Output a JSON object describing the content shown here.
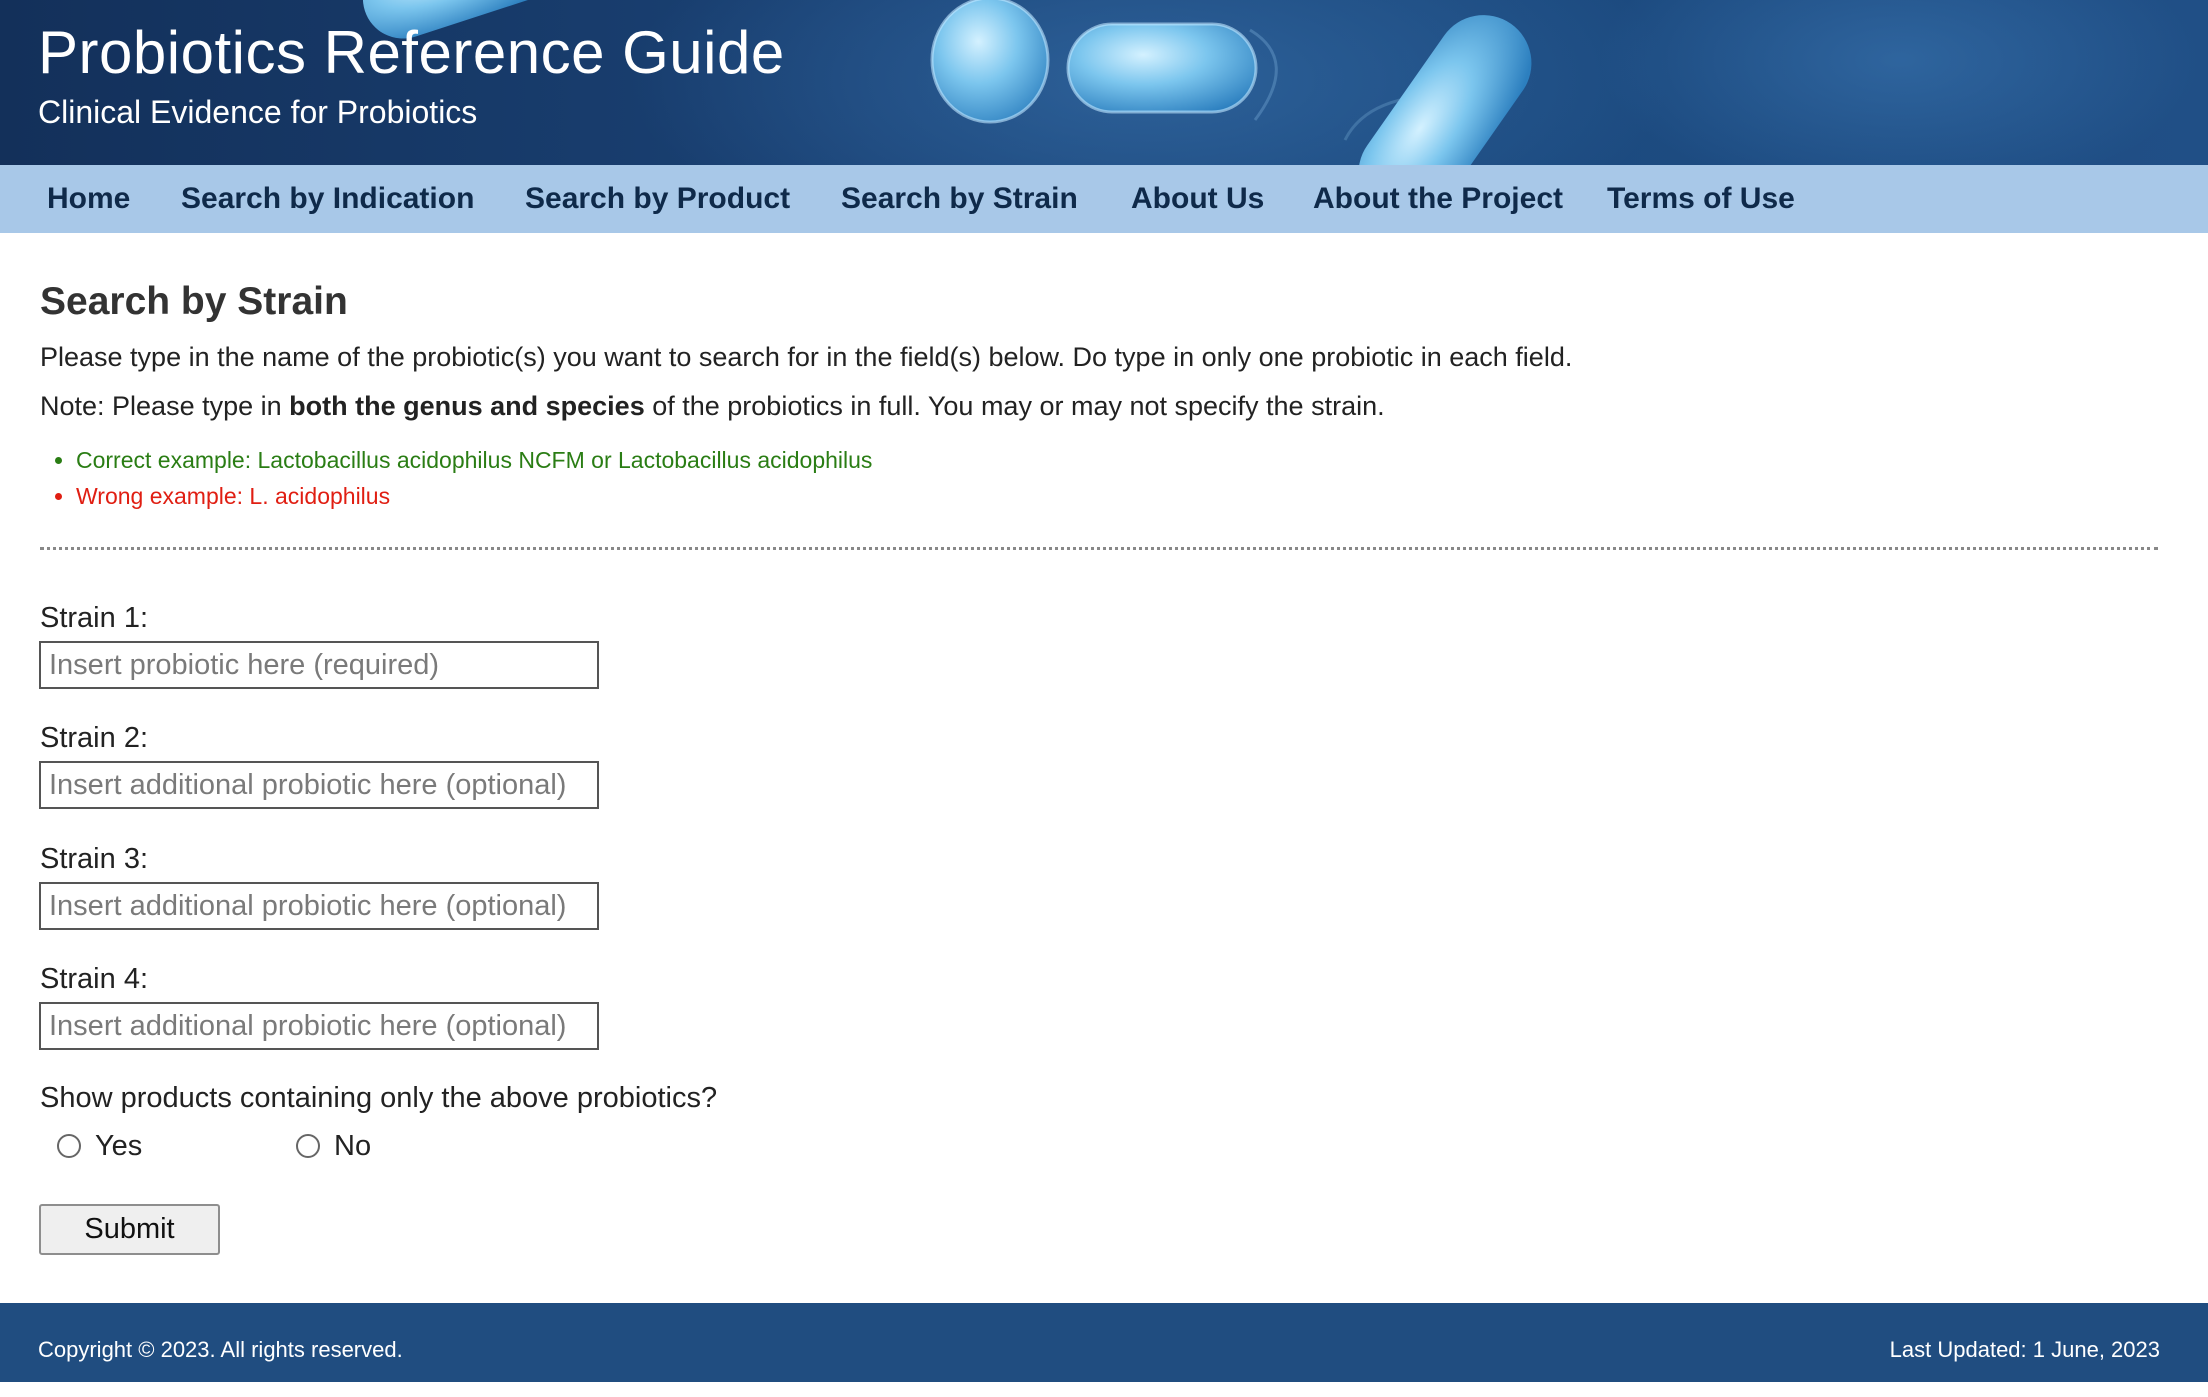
{
  "header": {
    "title": "Probiotics Reference Guide",
    "subtitle": "Clinical Evidence for Probiotics"
  },
  "nav": {
    "items": [
      {
        "label": "Home"
      },
      {
        "label": "Search by Indication"
      },
      {
        "label": "Search by Product"
      },
      {
        "label": "Search by Strain"
      },
      {
        "label": "About Us"
      },
      {
        "label": "About the Project"
      },
      {
        "label": "Terms of Use"
      }
    ]
  },
  "main": {
    "title": "Search by Strain",
    "intro": "Please type in the name of the probiotic(s) you want to search for in the field(s) below. Do type in only one probiotic in each field.",
    "note": {
      "prefix": "Note: Please type in ",
      "bold": "both the genus and species",
      "suffix": " of the probiotics in full. You may or may not specify the strain."
    },
    "examples": {
      "correct": "Correct example: Lactobacillus acidophilus NCFM or Lactobacillus acidophilus",
      "wrong": "Wrong example: L. acidophilus"
    },
    "fields": [
      {
        "label": "Strain 1:",
        "value": "",
        "placeholder": "Insert probiotic here (required)"
      },
      {
        "label": "Strain 2:",
        "value": "",
        "placeholder": "Insert additional probiotic here (optional)"
      },
      {
        "label": "Strain 3:",
        "value": "",
        "placeholder": "Insert additional probiotic here (optional)"
      },
      {
        "label": "Strain 4:",
        "value": "",
        "placeholder": "Insert additional probiotic here (optional)"
      }
    ],
    "question": "Show products containing only the above probiotics?",
    "options": {
      "yes": "Yes",
      "no": "No",
      "selected": null
    },
    "submit_label": "Submit"
  },
  "footer": {
    "copyright": "Copyright © 2023. All rights reserved.",
    "updated": "Last Updated: 1 June, 2023"
  },
  "colors": {
    "header_bg": "#1a4275",
    "nav_bg": "#a8c8e8",
    "nav_text": "#0f2a4a",
    "footer_bg": "#204d80",
    "correct": "#2a7d14",
    "wrong": "#e01e12"
  }
}
